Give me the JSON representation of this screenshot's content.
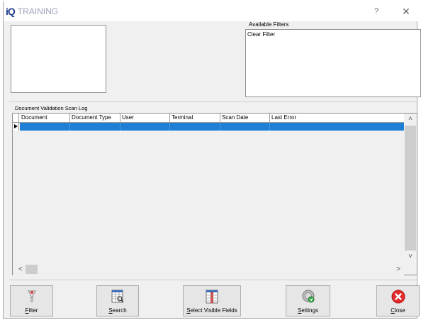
{
  "window": {
    "logo_text": "iQ",
    "title": "TRAINING",
    "help_label": "?",
    "close_label": "✕"
  },
  "filters": {
    "label": "Available Filters",
    "items": [
      "Clear Filter"
    ]
  },
  "grid": {
    "label": "Document Validation Scan Log",
    "columns": [
      "Document",
      "Document Type",
      "User",
      "Terminal",
      "Scan Date",
      "Last Error"
    ],
    "rows": [
      [
        "",
        "",
        "",
        "",
        "",
        ""
      ]
    ]
  },
  "scrollbars": {
    "up": "˄",
    "down": "˅",
    "left": "<",
    "right": ">"
  },
  "toolbar": {
    "filter_label": "Filter",
    "search_label": "Search",
    "fields_label": "Select Visible Fields",
    "settings_label": "Settings",
    "close_label": "Close"
  },
  "colors": {
    "selected_row": "#1e7fd4",
    "logo": "#1d3c8f",
    "close_icon": "#e22b2b"
  },
  "icons": {
    "filter": "funnel-icon",
    "search": "search-grid-icon",
    "fields": "columns-icon",
    "settings": "gear-globe-icon",
    "close": "close-circle-icon"
  }
}
